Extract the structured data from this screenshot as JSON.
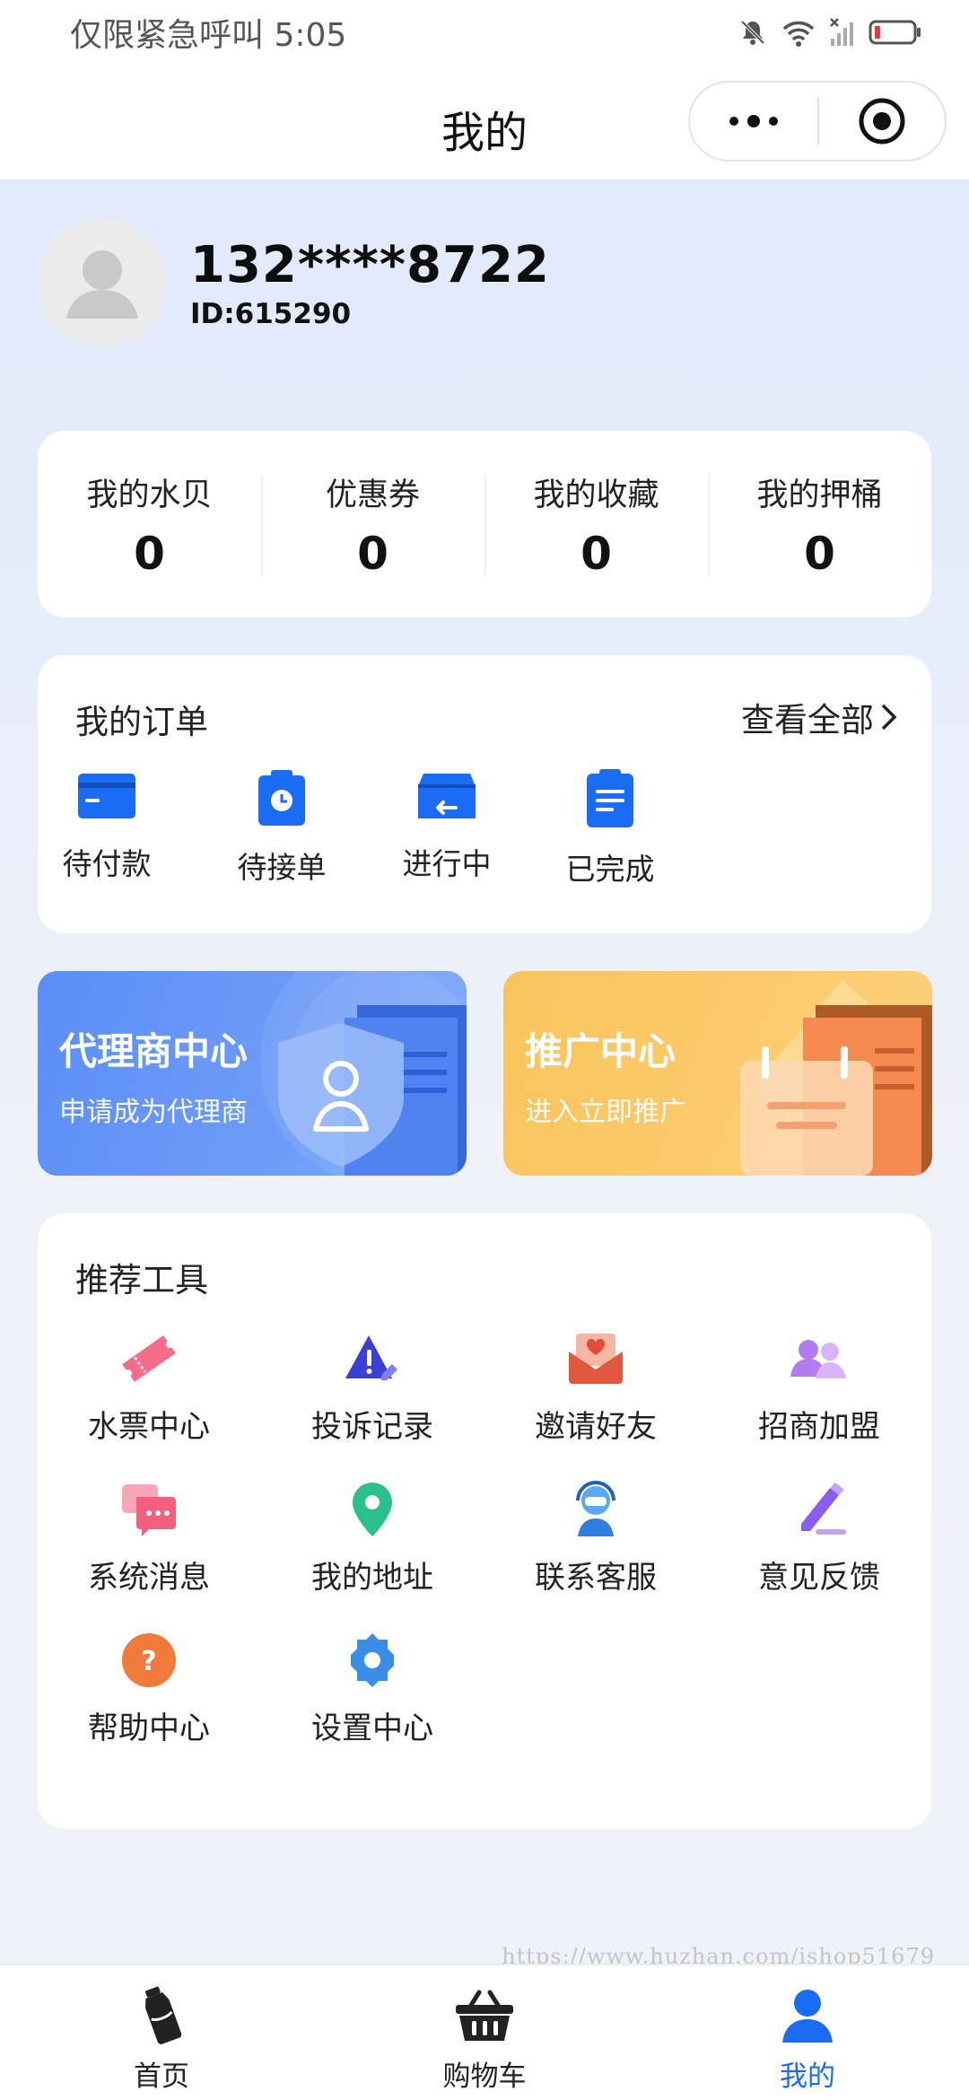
{
  "status_bar": {
    "carrier_text": "仅限紧急呼叫 5:05",
    "icons": [
      "bell-muted-icon",
      "wifi-icon",
      "no-signal-icon",
      "battery-low-icon"
    ]
  },
  "nav": {
    "title": "我的",
    "capsule_icons": [
      "more-dots-icon",
      "close-target-icon"
    ]
  },
  "profile": {
    "phone": "132****8722",
    "id_text": "ID:615290",
    "avatar_icon": "default-avatar-icon"
  },
  "stats": [
    {
      "label": "我的水贝",
      "value": "0"
    },
    {
      "label": "优惠券",
      "value": "0"
    },
    {
      "label": "我的收藏",
      "value": "0"
    },
    {
      "label": "我的押桶",
      "value": "0"
    }
  ],
  "orders": {
    "title": "我的订单",
    "view_all": "查看全部",
    "items": [
      {
        "label": "待付款",
        "icon": "wallet-card-icon"
      },
      {
        "label": "待接单",
        "icon": "clipboard-clock-icon"
      },
      {
        "label": "进行中",
        "icon": "box-return-icon"
      },
      {
        "label": "已完成",
        "icon": "document-done-icon"
      }
    ]
  },
  "promos": {
    "agent": {
      "title": "代理商中心",
      "subtitle": "申请成为代理商",
      "icon": "shield-user-icon"
    },
    "spread": {
      "title": "推广中心",
      "subtitle": "进入立即推广",
      "icon": "calendar-notes-icon"
    }
  },
  "tools": {
    "title": "推荐工具",
    "items": [
      {
        "label": "水票中心",
        "icon": "ticket-icon"
      },
      {
        "label": "投诉记录",
        "icon": "warning-edit-icon"
      },
      {
        "label": "邀请好友",
        "icon": "heart-envelope-icon"
      },
      {
        "label": "招商加盟",
        "icon": "people-group-icon"
      },
      {
        "label": "系统消息",
        "icon": "chat-bubbles-icon"
      },
      {
        "label": "我的地址",
        "icon": "location-pin-icon"
      },
      {
        "label": "联系客服",
        "icon": "customer-service-icon"
      },
      {
        "label": "意见反馈",
        "icon": "pencil-feedback-icon"
      },
      {
        "label": "帮助中心",
        "icon": "question-circle-icon"
      },
      {
        "label": "设置中心",
        "icon": "gear-icon"
      }
    ]
  },
  "watermark": "https://www.huzhan.com/ishop51679",
  "tabbar": [
    {
      "label": "首页",
      "icon": "water-bottle-icon",
      "active": false
    },
    {
      "label": "购物车",
      "icon": "basket-icon",
      "active": false
    },
    {
      "label": "我的",
      "icon": "user-icon",
      "active": true
    }
  ],
  "colors": {
    "accent": "#1a6cf5",
    "agent_banner": "#5b8ef7",
    "spread_banner": "#fac45c"
  }
}
